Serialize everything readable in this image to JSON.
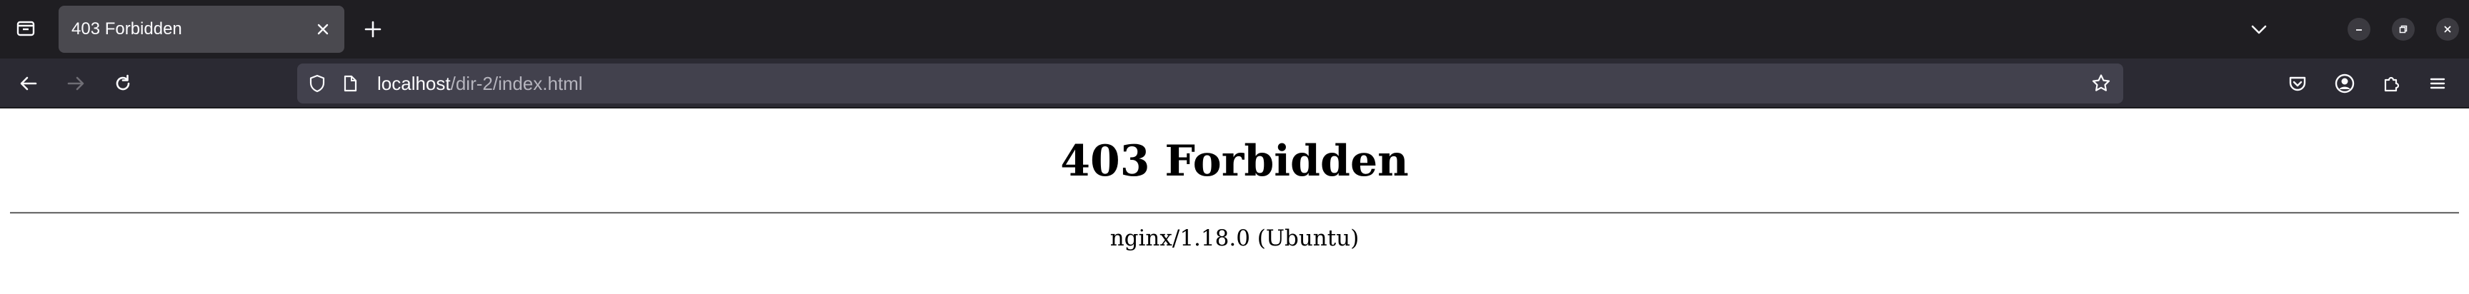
{
  "browser": {
    "tab": {
      "title": "403 Forbidden"
    },
    "icons": {
      "tab_list": "tab-list-icon",
      "close": "close-icon",
      "new_tab": "plus-icon",
      "all_tabs": "chevron-down-icon",
      "minimize": "minimize-icon",
      "restore": "restore-icon",
      "window_close": "close-icon",
      "back": "arrow-left-icon",
      "forward": "arrow-right-icon",
      "reload": "reload-icon",
      "shield": "shield-icon",
      "page": "page-icon",
      "bookmark": "star-icon",
      "pocket": "pocket-icon",
      "account": "account-icon",
      "extensions": "puzzle-icon",
      "menu": "hamburger-menu-icon"
    },
    "urlbar": {
      "host": "localhost",
      "path": "/dir-2/index.html"
    },
    "colors": {
      "tabstrip": "#1f1e22",
      "active_tab": "#4a494f",
      "navbar": "#2b2a33",
      "urlbar": "#42414d",
      "icon": "#fbfbfe",
      "icon_disabled": "#6f6e75"
    }
  },
  "page": {
    "heading": "403 Forbidden",
    "server": "nginx/1.18.0 (Ubuntu)"
  }
}
